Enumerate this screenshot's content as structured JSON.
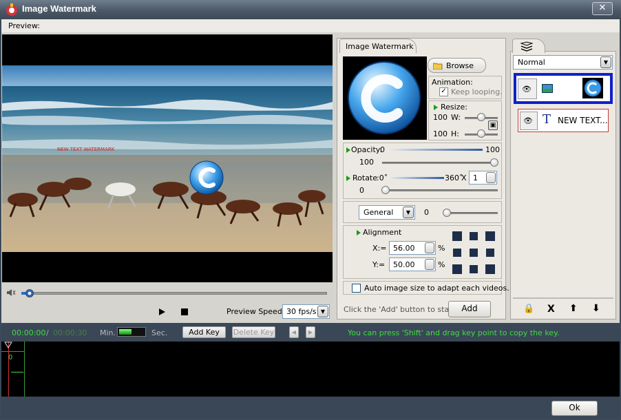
{
  "window": {
    "title": "Image Watermark",
    "close_label": "✕"
  },
  "menu": {
    "preview_label": "Preview:"
  },
  "video": {
    "overlay_text": "NEW TEXT WATERMARK"
  },
  "playback": {
    "speed_label": "Preview Speed:",
    "speed_value": "30 fps/s"
  },
  "watermark_panel": {
    "tab_label": "Image Watermark",
    "browse_label": "Browse",
    "animation_label": "Animation:",
    "keep_looping_label": "Keep looping.",
    "resize_label": "Resize:",
    "w_value": "100",
    "w_label": "W:",
    "h_value": "100",
    "h_label": "H:",
    "opacity_label": "Opacity:",
    "opacity_min": "0",
    "opacity_max": "100",
    "opacity_value": "100",
    "rotate_label": "Rotate",
    "rotate_min": ":0˚",
    "rotate_max": "360˚",
    "rotate_x": "X",
    "rotate_times": "1",
    "rotate_value": "0",
    "blend_mode": "General",
    "blend_value": "0",
    "alignment_label": "Alignment",
    "x_label": "X:=",
    "x_value": "56.00",
    "y_label": "Y:=",
    "y_value": "50.00",
    "pct": "%",
    "auto_size_label": "Auto image size to adapt each videos.",
    "hint_text": "Click the 'Add' button to start ->",
    "add_label": "Add"
  },
  "layers": {
    "blend_select": "Normal",
    "items": [
      {
        "type": "image",
        "label": ""
      },
      {
        "type": "text",
        "label": "NEW TEXT..."
      }
    ],
    "toolbar": {
      "lock": "🔒",
      "delete": "X",
      "up": "⬆",
      "down": "⬇"
    }
  },
  "timeline": {
    "time_current": "00:00:00",
    "separator": "/",
    "time_total": "00:00:30",
    "min_label": "Min.",
    "sec_label": "Sec.",
    "add_key_label": "Add Key",
    "delete_key_label": "Delete Key",
    "hint": "You can press 'Shift' and drag key point to copy the key.",
    "ruler_zero": "0"
  },
  "footer": {
    "ok_label": "Ok"
  },
  "colors": {
    "accent_green": "#3fdd3f",
    "selection_blue": "#1020c8",
    "text_red_border": "#c23a3a"
  }
}
